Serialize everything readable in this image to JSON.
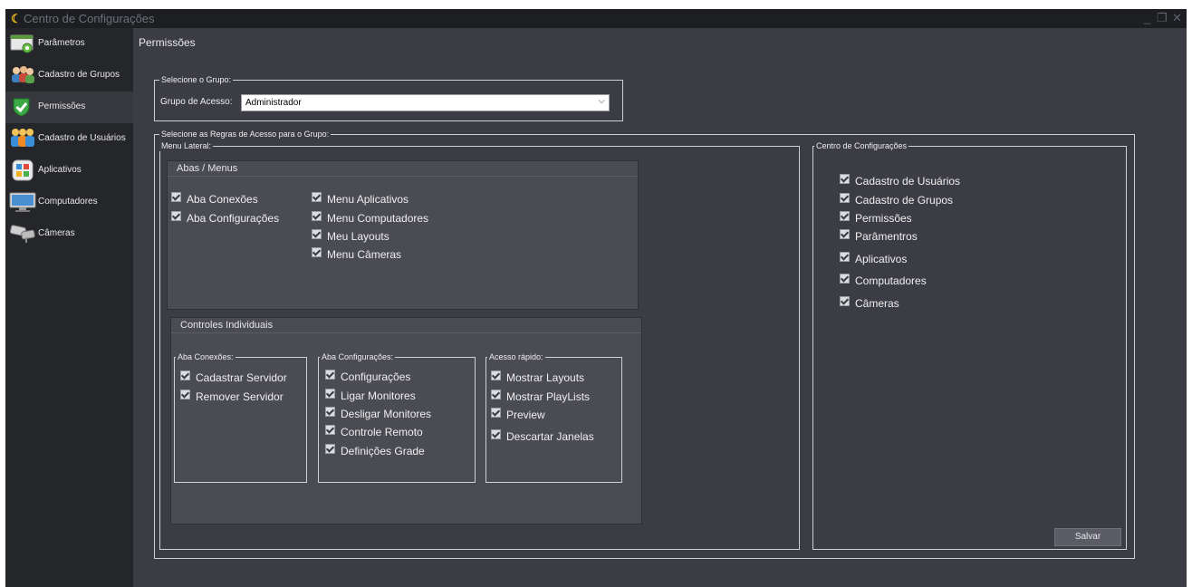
{
  "window": {
    "title": "Centro de Configurações"
  },
  "sidebar": {
    "items": [
      {
        "label": "Parâmetros",
        "icon": "parameters-icon"
      },
      {
        "label": "Cadastro de Grupos",
        "icon": "groups-icon"
      },
      {
        "label": "Permissões",
        "icon": "shield-check-icon"
      },
      {
        "label": "Cadastro de Usuários",
        "icon": "users-icon"
      },
      {
        "label": "Aplicativos",
        "icon": "apps-icon"
      },
      {
        "label": "Computadores",
        "icon": "monitor-icon"
      },
      {
        "label": "Câmeras",
        "icon": "camera-icon"
      }
    ],
    "active_index": 2
  },
  "page": {
    "title": "Permissões"
  },
  "group_select": {
    "legend": "Selecione o Grupo:",
    "label": "Grupo de Acesso:",
    "value": "Administrador"
  },
  "rules": {
    "legend": "Selecione as Regras de Acesso para o Grupo:",
    "menu_lateral": {
      "legend": "Menu Lateral:",
      "abas_menus": {
        "title": "Abas / Menus",
        "col1": [
          "Aba Conexões",
          "Aba Configurações"
        ],
        "col2": [
          "Menu Aplicativos",
          "Menu Computadores",
          "Meu Layouts",
          "Menu Câmeras"
        ]
      },
      "controles": {
        "title": "Controles Individuais",
        "aba_conexoes": {
          "legend": "Aba Conexões:",
          "items": [
            "Cadastrar Servidor",
            "Remover Servidor"
          ]
        },
        "aba_config": {
          "legend": "Aba Configurações:",
          "items": [
            "Configurações",
            "Ligar Monitores",
            "Desligar Monitores",
            "Controle Remoto",
            "Definições Grade"
          ]
        },
        "acesso_rapido": {
          "legend": "Acesso rápido:",
          "items": [
            "Mostrar Layouts",
            "Mostrar PlayLists",
            "Preview",
            "Descartar Janelas"
          ]
        }
      }
    },
    "centro": {
      "legend": "Centro de Configurações",
      "items": [
        "Cadastro de Usuários",
        "Cadastro de Grupos",
        "Permissões",
        "Parâmentros",
        "Aplicativos",
        "Computadores",
        "Câmeras"
      ]
    }
  },
  "actions": {
    "save_label": "Salvar"
  },
  "colors": {
    "background": "#3c3d44",
    "sidebar": "#25262a",
    "panel": "#4a4b53",
    "accent": "#f2b823"
  }
}
